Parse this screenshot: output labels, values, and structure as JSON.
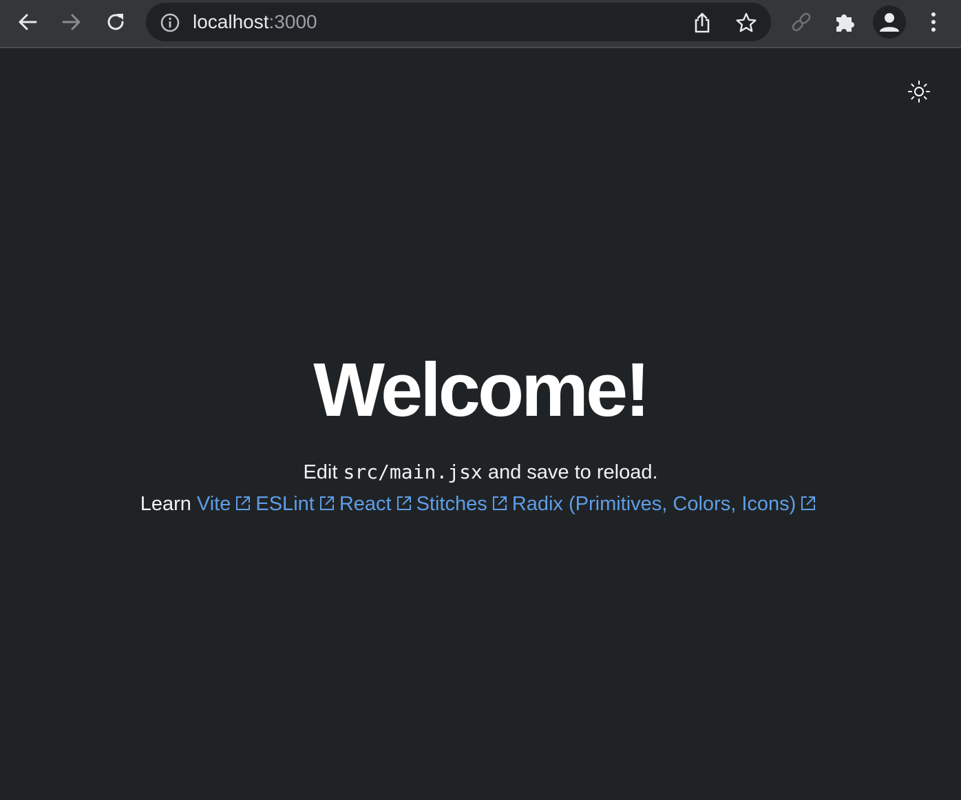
{
  "browser": {
    "url_host": "localhost",
    "url_port": ":3000",
    "icons": {
      "back": "arrow-left",
      "forward": "arrow-right",
      "reload": "reload",
      "site_info": "info-circle",
      "share": "share",
      "bookmark": "star",
      "link": "link",
      "extensions": "puzzle",
      "profile": "person",
      "menu": "dots-vertical"
    }
  },
  "page": {
    "background": "#202325",
    "link_color": "#5f9ee8",
    "theme_toggle_icon": "sun",
    "title": "Welcome!",
    "edit_prefix": "Edit",
    "edit_code": "src/main.jsx",
    "edit_suffix": "and save to reload.",
    "learn_prefix": "Learn",
    "links": [
      {
        "label": "Vite"
      },
      {
        "label": "ESLint"
      },
      {
        "label": "React"
      },
      {
        "label": "Stitches"
      },
      {
        "label": "Radix (Primitives, Colors, Icons)"
      }
    ]
  }
}
